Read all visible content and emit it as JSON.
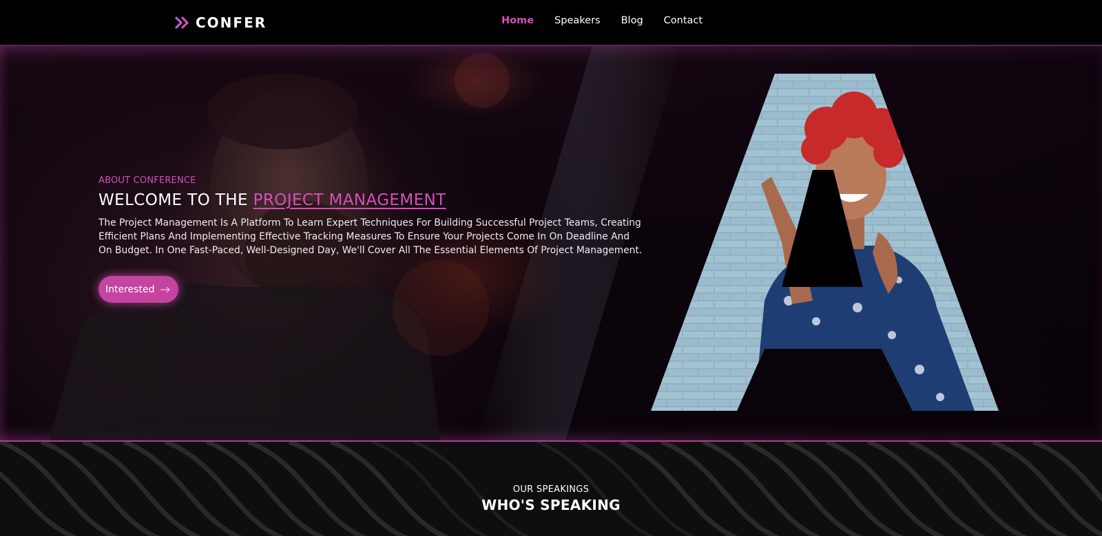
{
  "brand": {
    "name": "CONFER",
    "icon": "double-chevron-right-icon",
    "accent": "#d54fbc"
  },
  "nav": {
    "items": [
      {
        "label": "Home",
        "active": true
      },
      {
        "label": "Speakers",
        "active": false
      },
      {
        "label": "Blog",
        "active": false
      },
      {
        "label": "Contact",
        "active": false
      }
    ]
  },
  "hero": {
    "eyebrow": "ABOUT CONFERENCE",
    "title_prefix": "WELCOME TO THE",
    "title_accent": "PROJECT MANAGEMENT",
    "description": "The Project Management Is A Platform To Learn Expert Techniques For Building Successful Project Teams, Creating Efficient Plans And Implementing Effective Tracking Measures To Ensure Your Projects Come In On Deadline And On Budget. In One Fast-Paced, Well-Designed Day, We'll Cover All The Essential Elements Of Project Management.",
    "cta_label": "Interested",
    "cta_icon": "arrow-right-icon"
  },
  "speakers": {
    "eyebrow": "OUR SPEAKINGS",
    "title": "WHO'S SPEAKING"
  },
  "colors": {
    "accent": "#d54fbc",
    "button": "#c4449f",
    "navbar": "#000000",
    "section_bg": "#0e0e0e"
  }
}
